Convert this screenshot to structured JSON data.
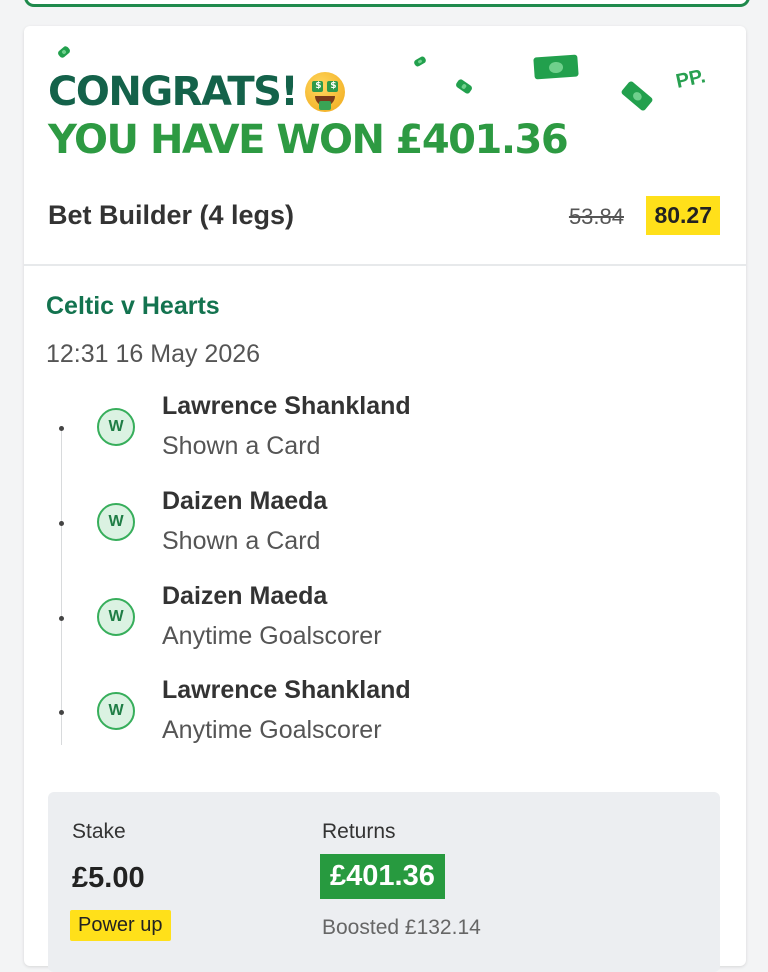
{
  "header": {
    "congrats": "CONGRATS!",
    "congrats_emoji": "money-mouth-face",
    "won_text": "YOU HAVE WON",
    "won_amount": "£401.36",
    "brand_mark": "PP.",
    "colors": {
      "dark_green": "#14624a",
      "bright_green": "#2d9a42",
      "highlight_yellow": "#ffe01a"
    }
  },
  "bet": {
    "title": "Bet Builder (4 legs)",
    "original_odds": "53.84",
    "boosted_odds": "80.27"
  },
  "event": {
    "name": "Celtic v Hearts",
    "datetime": "12:31 16 May 2026"
  },
  "legs": [
    {
      "result": "W",
      "player": "Lawrence Shankland",
      "market": "Shown a Card"
    },
    {
      "result": "W",
      "player": "Daizen Maeda",
      "market": "Shown a Card"
    },
    {
      "result": "W",
      "player": "Daizen Maeda",
      "market": "Anytime Goalscorer"
    },
    {
      "result": "W",
      "player": "Lawrence Shankland",
      "market": "Anytime Goalscorer"
    }
  ],
  "summary": {
    "stake_label": "Stake",
    "stake_value": "£5.00",
    "returns_label": "Returns",
    "returns_value": "£401.36",
    "power_up_label": "Power up",
    "boosted_text": "Boosted £132.14"
  }
}
